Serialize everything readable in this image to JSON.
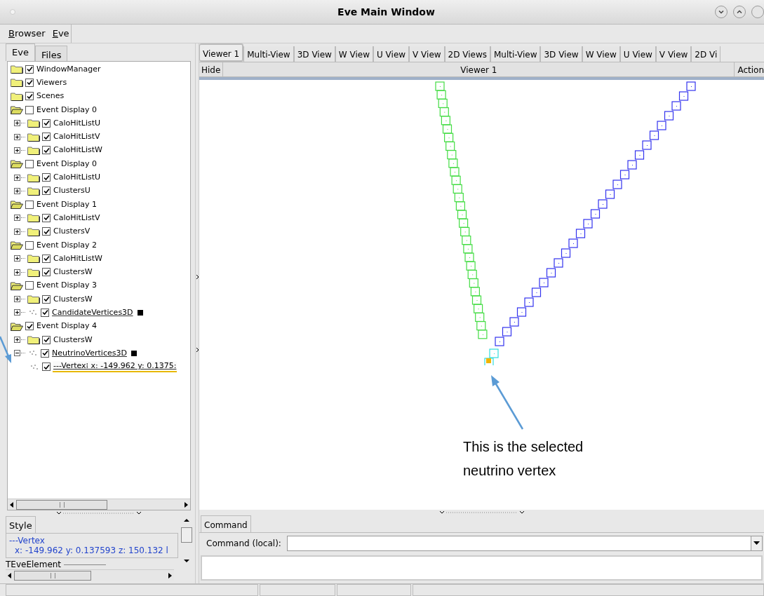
{
  "window": {
    "title": "Eve Main Window"
  },
  "menu": [
    {
      "label": "Browser"
    },
    {
      "label": "Eve"
    }
  ],
  "left_tabs": [
    {
      "label": "Eve",
      "selected": true
    },
    {
      "label": "Files",
      "selected": false
    }
  ],
  "tree": [
    {
      "label": "WindowManager",
      "kind": "folder",
      "checked": true,
      "expanded": false
    },
    {
      "label": "Viewers",
      "kind": "folder",
      "checked": true,
      "expanded": false
    },
    {
      "label": "Scenes",
      "kind": "folder",
      "checked": true,
      "expanded": false
    },
    {
      "label": "Event Display 0",
      "kind": "folder",
      "checked": false,
      "expanded": true,
      "children": [
        {
          "label": "CaloHitListU",
          "kind": "folder",
          "checked": true,
          "expanded": false
        },
        {
          "label": "CaloHitListV",
          "kind": "folder",
          "checked": true,
          "expanded": false
        },
        {
          "label": "CaloHitListW",
          "kind": "folder",
          "checked": true,
          "expanded": false
        }
      ]
    },
    {
      "label": "Event Display 0",
      "kind": "folder",
      "checked": false,
      "expanded": true,
      "children": [
        {
          "label": "CaloHitListU",
          "kind": "folder",
          "checked": true,
          "expanded": false
        },
        {
          "label": "ClustersU",
          "kind": "folder",
          "checked": true,
          "expanded": false
        }
      ]
    },
    {
      "label": "Event Display 1",
      "kind": "folder",
      "checked": false,
      "expanded": true,
      "children": [
        {
          "label": "CaloHitListV",
          "kind": "folder",
          "checked": true,
          "expanded": false
        },
        {
          "label": "ClustersV",
          "kind": "folder",
          "checked": true,
          "expanded": false
        }
      ]
    },
    {
      "label": "Event Display 2",
      "kind": "folder",
      "checked": false,
      "expanded": true,
      "children": [
        {
          "label": "CaloHitListW",
          "kind": "folder",
          "checked": true,
          "expanded": false
        },
        {
          "label": "ClustersW",
          "kind": "folder",
          "checked": true,
          "expanded": false
        }
      ]
    },
    {
      "label": "Event Display 3",
      "kind": "folder",
      "checked": false,
      "expanded": true,
      "children": [
        {
          "label": "ClustersW",
          "kind": "folder",
          "checked": true,
          "expanded": false
        },
        {
          "label": "CandidateVertices3D",
          "kind": "points",
          "checked": true,
          "expanded": false,
          "color": "#000000"
        }
      ]
    },
    {
      "label": "Event Display 4",
      "kind": "folder",
      "checked": true,
      "expanded": true,
      "children": [
        {
          "label": "ClustersW",
          "kind": "folder",
          "checked": true,
          "expanded": false
        },
        {
          "label": "NeutrinoVertices3D",
          "kind": "points",
          "checked": true,
          "expanded": true,
          "color": "#000000",
          "children": [
            {
              "label": "---Vertex⁞  x: -149.962  y: 0.1375:",
              "kind": "point",
              "checked": true,
              "selected": true
            }
          ]
        }
      ]
    }
  ],
  "style_tab": {
    "label": "Style"
  },
  "style_panel": {
    "name": "---Vertex",
    "coords": "x: -149.962  y: 0.137593  z: 150.132 l",
    "section": "TEveElement"
  },
  "view_tabs": [
    {
      "label": "Viewer 1",
      "selected": true
    },
    {
      "label": "Multi-View",
      "selected": false
    },
    {
      "label": "3D View",
      "selected": false
    },
    {
      "label": "W View",
      "selected": false
    },
    {
      "label": "U View",
      "selected": false
    },
    {
      "label": "V View",
      "selected": false
    },
    {
      "label": "2D Views",
      "selected": false
    },
    {
      "label": "Multi-View",
      "selected": false
    },
    {
      "label": "3D View",
      "selected": false
    },
    {
      "label": "W View",
      "selected": false
    },
    {
      "label": "U View",
      "selected": false
    },
    {
      "label": "V View",
      "selected": false
    },
    {
      "label": "2D Vi",
      "selected": false
    }
  ],
  "viewer_header": {
    "hide": "Hide",
    "title": "Viewer 1",
    "actions": "Action"
  },
  "command": {
    "tab": "Command",
    "label": "Command (local):"
  },
  "annotation": {
    "text": "This is the selected neutrino vertex"
  }
}
